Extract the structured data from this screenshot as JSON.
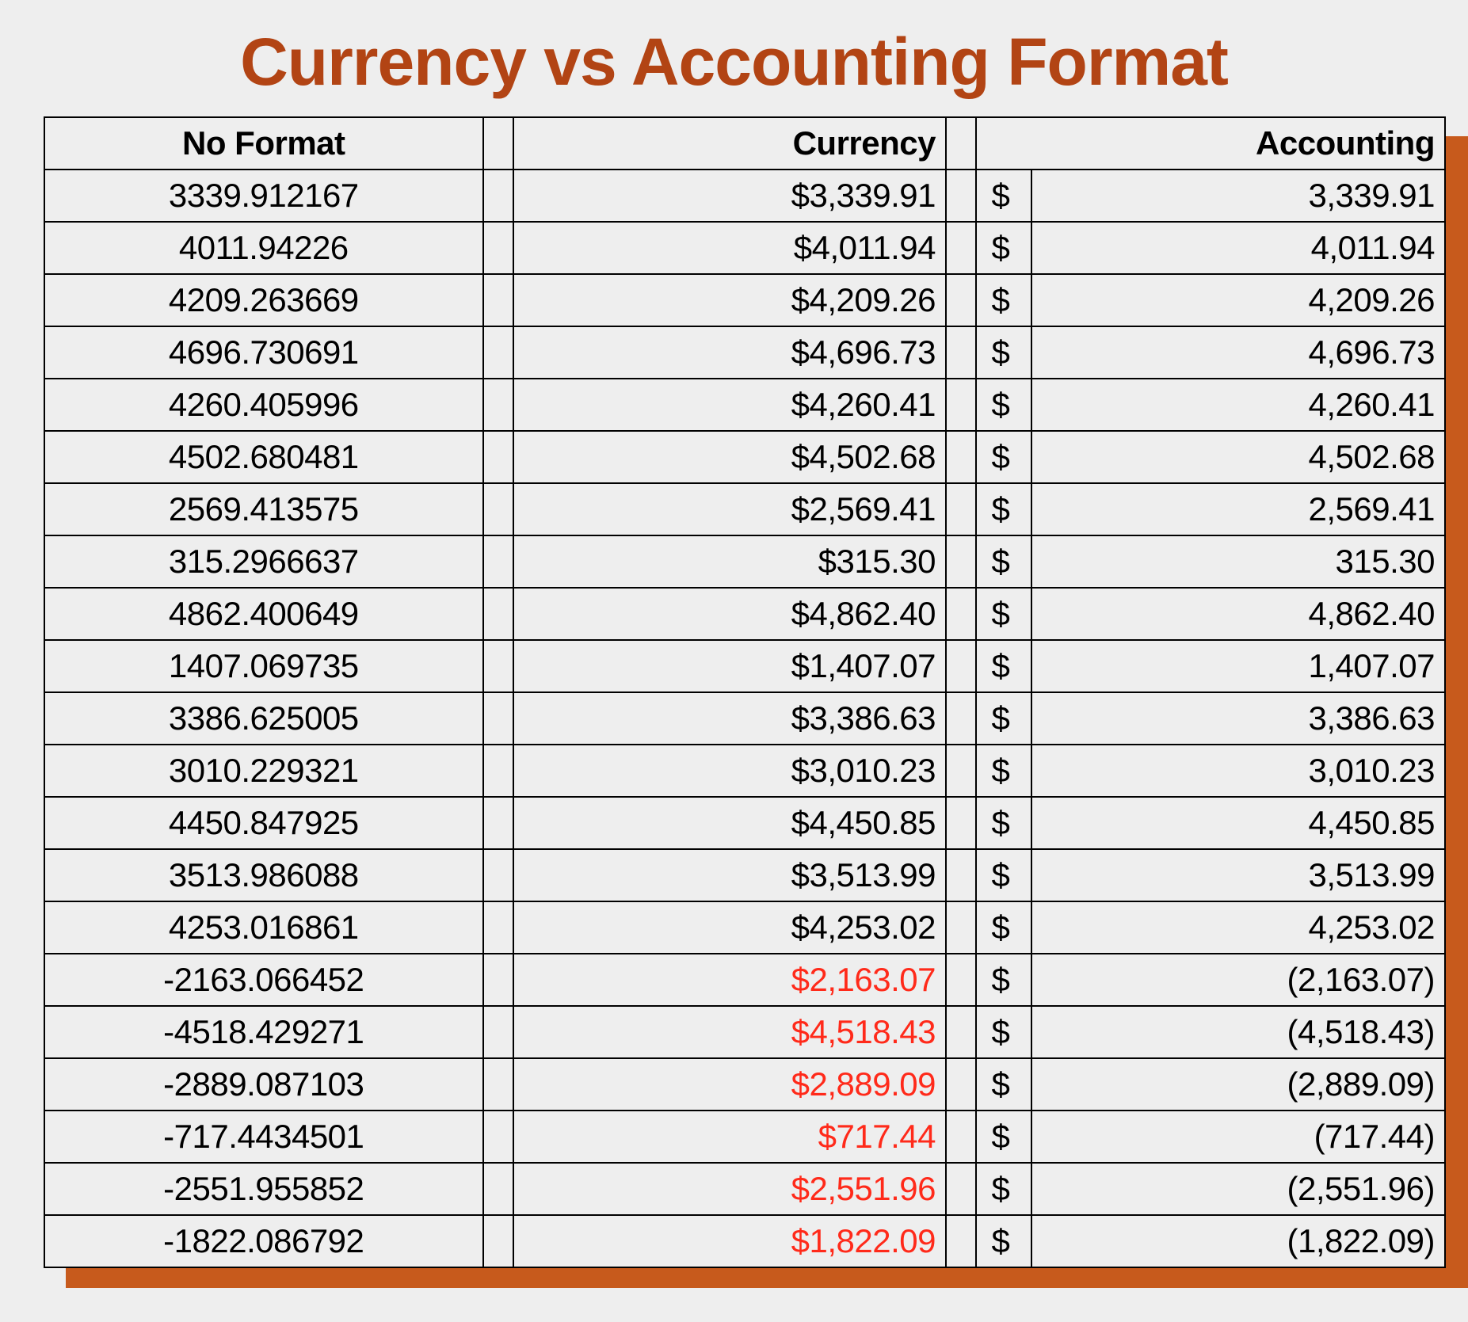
{
  "title": "Currency vs Accounting Format",
  "headers": {
    "noformat": "No Format",
    "currency": "Currency",
    "accounting": "Accounting"
  },
  "dollar": "$",
  "rows": [
    {
      "no": "3339.912167",
      "cur": "$3,339.91",
      "cur_neg": false,
      "acc": "3,339.91"
    },
    {
      "no": "4011.94226",
      "cur": "$4,011.94",
      "cur_neg": false,
      "acc": "4,011.94"
    },
    {
      "no": "4209.263669",
      "cur": "$4,209.26",
      "cur_neg": false,
      "acc": "4,209.26"
    },
    {
      "no": "4696.730691",
      "cur": "$4,696.73",
      "cur_neg": false,
      "acc": "4,696.73"
    },
    {
      "no": "4260.405996",
      "cur": "$4,260.41",
      "cur_neg": false,
      "acc": "4,260.41"
    },
    {
      "no": "4502.680481",
      "cur": "$4,502.68",
      "cur_neg": false,
      "acc": "4,502.68"
    },
    {
      "no": "2569.413575",
      "cur": "$2,569.41",
      "cur_neg": false,
      "acc": "2,569.41"
    },
    {
      "no": "315.2966637",
      "cur": "$315.30",
      "cur_neg": false,
      "acc": "315.30"
    },
    {
      "no": "4862.400649",
      "cur": "$4,862.40",
      "cur_neg": false,
      "acc": "4,862.40"
    },
    {
      "no": "1407.069735",
      "cur": "$1,407.07",
      "cur_neg": false,
      "acc": "1,407.07"
    },
    {
      "no": "3386.625005",
      "cur": "$3,386.63",
      "cur_neg": false,
      "acc": "3,386.63"
    },
    {
      "no": "3010.229321",
      "cur": "$3,010.23",
      "cur_neg": false,
      "acc": "3,010.23"
    },
    {
      "no": "4450.847925",
      "cur": "$4,450.85",
      "cur_neg": false,
      "acc": "4,450.85"
    },
    {
      "no": "3513.986088",
      "cur": "$3,513.99",
      "cur_neg": false,
      "acc": "3,513.99"
    },
    {
      "no": "4253.016861",
      "cur": "$4,253.02",
      "cur_neg": false,
      "acc": "4,253.02"
    },
    {
      "no": "-2163.066452",
      "cur": "$2,163.07",
      "cur_neg": true,
      "acc": "(2,163.07)"
    },
    {
      "no": "-4518.429271",
      "cur": "$4,518.43",
      "cur_neg": true,
      "acc": "(4,518.43)"
    },
    {
      "no": "-2889.087103",
      "cur": "$2,889.09",
      "cur_neg": true,
      "acc": "(2,889.09)"
    },
    {
      "no": "-717.4434501",
      "cur": "$717.44",
      "cur_neg": true,
      "acc": "(717.44)"
    },
    {
      "no": "-2551.955852",
      "cur": "$2,551.96",
      "cur_neg": true,
      "acc": "(2,551.96)"
    },
    {
      "no": "-1822.086792",
      "cur": "$1,822.09",
      "cur_neg": true,
      "acc": "(1,822.09)"
    }
  ]
}
